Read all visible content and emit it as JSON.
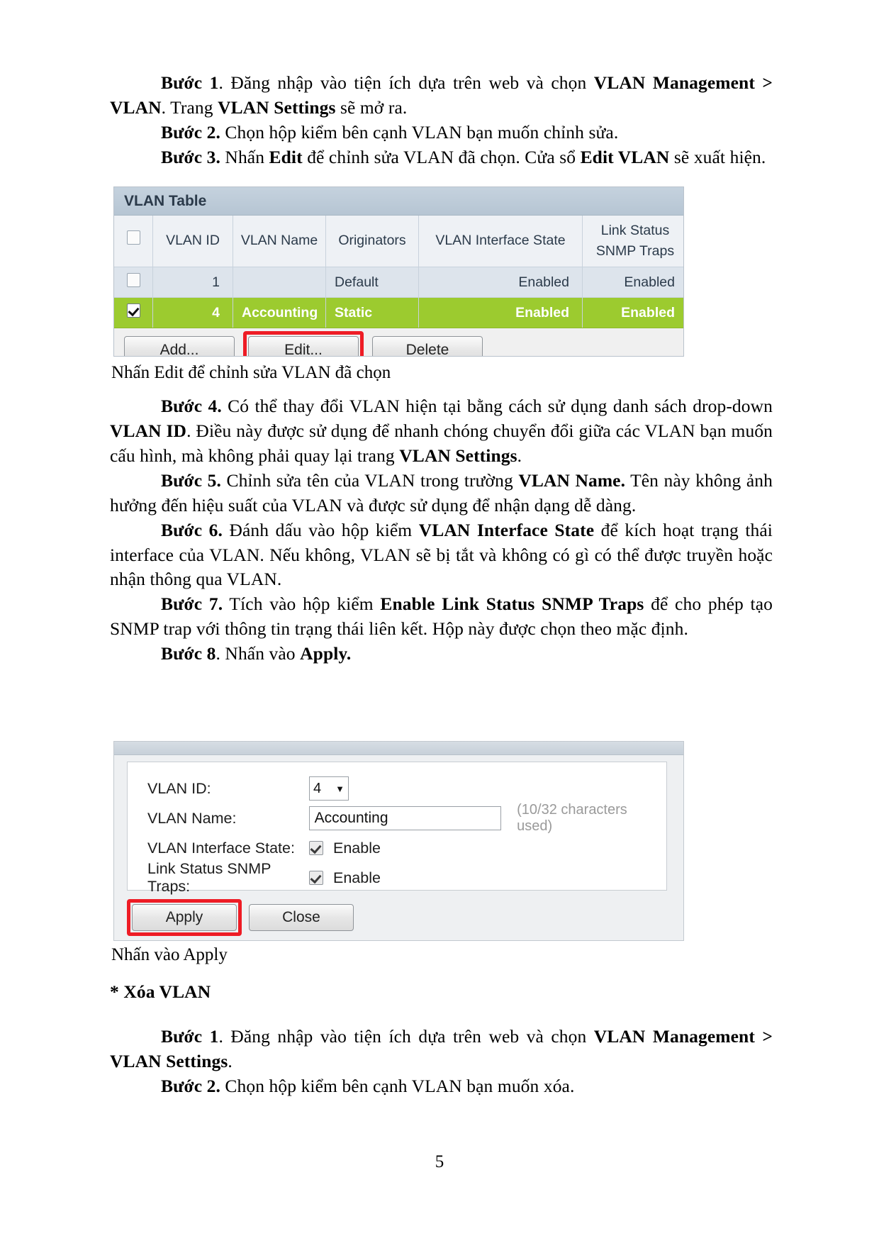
{
  "document": {
    "page_number": "5",
    "paragraphs": [
      {
        "id": "step1",
        "runs": [
          {
            "t": "Bước 1",
            "b": true
          },
          {
            "t": ". Đăng nhập vào tiện ích dựa trên web và chọn ",
            "b": false
          },
          {
            "t": "VLAN Management > VLAN",
            "b": true
          },
          {
            "t": ". Trang ",
            "b": false
          },
          {
            "t": "VLAN Settings",
            "b": true
          },
          {
            "t": " sẽ mở ra.",
            "b": false
          }
        ]
      },
      {
        "id": "step2",
        "runs": [
          {
            "t": "Bước 2.",
            "b": true
          },
          {
            "t": " Chọn hộp kiểm bên cạnh VLAN bạn muốn chỉnh sửa.",
            "b": false
          }
        ]
      },
      {
        "id": "step3",
        "runs": [
          {
            "t": "Bước 3.",
            "b": true
          },
          {
            "t": " Nhấn ",
            "b": false
          },
          {
            "t": "Edit",
            "b": true
          },
          {
            "t": " để chỉnh sửa VLAN đã chọn. Cửa sổ ",
            "b": false
          },
          {
            "t": "Edit VLAN",
            "b": true
          },
          {
            "t": " sẽ xuất hiện.",
            "b": false
          }
        ]
      },
      {
        "id": "step4",
        "runs": [
          {
            "t": "Bước 4.",
            "b": true
          },
          {
            "t": " Có thể thay đổi VLAN hiện tại bằng cách sử dụng danh sách drop-down ",
            "b": false
          },
          {
            "t": "VLAN ID",
            "b": true
          },
          {
            "t": ". Điều này được sử dụng để nhanh chóng chuyển đổi giữa các VLAN bạn muốn cấu hình, mà không phải quay lại trang ",
            "b": false
          },
          {
            "t": "VLAN Settings",
            "b": true
          },
          {
            "t": ".",
            "b": false
          }
        ]
      },
      {
        "id": "step5",
        "runs": [
          {
            "t": "Bước 5.",
            "b": true
          },
          {
            "t": " Chỉnh sửa tên của VLAN trong trường ",
            "b": false
          },
          {
            "t": "VLAN Name.",
            "b": true
          },
          {
            "t": " Tên này không ảnh hưởng đến hiệu suất của VLAN và được sử dụng để nhận dạng dễ dàng.",
            "b": false
          }
        ]
      },
      {
        "id": "step6",
        "runs": [
          {
            "t": "Bước 6.",
            "b": true
          },
          {
            "t": " Đánh dấu vào hộp kiểm ",
            "b": false
          },
          {
            "t": "VLAN Interface State",
            "b": true
          },
          {
            "t": " để kích hoạt trạng thái interface của VLAN. Nếu không, VLAN sẽ bị tắt và không có gì có thể được truyền hoặc nhận thông qua VLAN.",
            "b": false
          }
        ]
      },
      {
        "id": "step7",
        "runs": [
          {
            "t": "Bước 7.",
            "b": true
          },
          {
            "t": " Tích vào hộp kiểm ",
            "b": false
          },
          {
            "t": "Enable Link Status SNMP Traps",
            "b": true
          },
          {
            "t": " để cho phép tạo SNMP trap với thông tin trạng thái liên kết. Hộp này được chọn theo mặc định.",
            "b": false
          }
        ]
      },
      {
        "id": "step8",
        "runs": [
          {
            "t": "Bước 8",
            "b": true
          },
          {
            "t": ". Nhấn vào ",
            "b": false
          },
          {
            "t": "Apply.",
            "b": true
          }
        ]
      },
      {
        "id": "del-heading",
        "runs": [
          {
            "t": "* Xóa VLAN",
            "b": true
          }
        ]
      },
      {
        "id": "del-step1",
        "runs": [
          {
            "t": "Bước 1",
            "b": true
          },
          {
            "t": ". Đăng nhập vào tiện ích dựa trên web và chọn ",
            "b": false
          },
          {
            "t": "VLAN Management > VLAN Settings",
            "b": true
          },
          {
            "t": ".",
            "b": false
          }
        ]
      },
      {
        "id": "del-step2",
        "runs": [
          {
            "t": "Bước 2.",
            "b": true
          },
          {
            "t": " Chọn hộp kiểm bên cạnh VLAN bạn muốn xóa.",
            "b": false
          }
        ]
      }
    ],
    "captions": {
      "vlan_table": "Nhấn Edit để chỉnh sửa VLAN đã chọn",
      "edit_vlan": "Nhấn vào Apply"
    }
  },
  "vlan_table_screenshot": {
    "panel_title": "VLAN Table",
    "columns": [
      "VLAN ID",
      "VLAN Name",
      "Originators",
      "VLAN Interface State",
      "Link Status",
      "SNMP Traps"
    ],
    "rows": [
      {
        "checked": false,
        "vlan_id": "1",
        "vlan_name": "",
        "originators": "Default",
        "interface_state": "Enabled",
        "link_status_snmp_traps": "Enabled",
        "selected": false
      },
      {
        "checked": true,
        "vlan_id": "4",
        "vlan_name": "Accounting",
        "originators": "Static",
        "interface_state": "Enabled",
        "link_status_snmp_traps": "Enabled",
        "selected": true
      }
    ],
    "buttons": {
      "add": "Add...",
      "edit": "Edit...",
      "delete": "Delete"
    },
    "highlight_color": "#ee1c25",
    "selected_row_color": "#9ccb2f"
  },
  "edit_vlan_screenshot": {
    "fields": {
      "vlan_id_label": "VLAN ID:",
      "vlan_id_value": "4",
      "vlan_name_label": "VLAN Name:",
      "vlan_name_value": "Accounting",
      "vlan_name_hint": "(10/32 characters used)",
      "interface_state_label": "VLAN Interface State:",
      "interface_state_enable": "Enable",
      "interface_state_checked": true,
      "snmp_traps_label": "Link Status SNMP Traps:",
      "snmp_traps_enable": "Enable",
      "snmp_traps_checked": true
    },
    "buttons": {
      "apply": "Apply",
      "close": "Close"
    },
    "highlight_color": "#ee1c25"
  }
}
